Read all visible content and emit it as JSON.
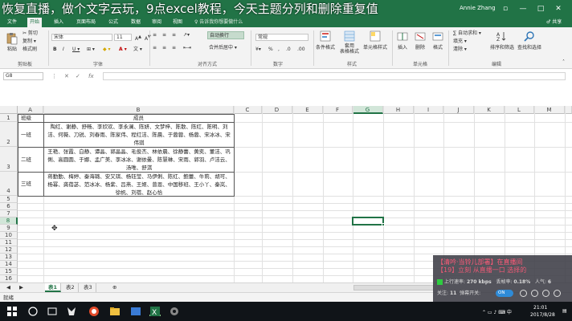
{
  "title_overlay": "恢复直播，做个文字云玩，9点excel教程，今天主题分列和删除重复值",
  "user_name": "Annie Zhang",
  "window_controls": {
    "restore": "▫",
    "minimize": "—",
    "maximize": "□",
    "close": "✕"
  },
  "menu_tabs": [
    "文件",
    "开始",
    "插入",
    "页面布局",
    "公式",
    "数据",
    "审阅",
    "视图"
  ],
  "active_tab_index": 1,
  "tell_me": "♀ 告诉我你想要做什么",
  "share": "♂ 共享",
  "ribbon": {
    "clipboard": {
      "paste": "粘贴",
      "cut": "✂ 剪切",
      "copy": "复制 ▾",
      "format_painter": "格式刷",
      "label": "剪贴板"
    },
    "font": {
      "font_name": "宋体",
      "font_size": "11",
      "label": "字体"
    },
    "alignment": {
      "wrap_text": "自动换行",
      "merge": "合并后居中 ▾",
      "label": "对齐方式"
    },
    "number": {
      "format": "常规",
      "label": "数字"
    },
    "styles": {
      "conditional": "条件格式",
      "table": "套用\n表格格式",
      "cell_styles": "单元格样式",
      "label": "样式"
    },
    "cells": {
      "insert": "插入",
      "delete": "删除",
      "format": "格式",
      "label": "单元格"
    },
    "editing": {
      "autosum": "∑ 自动求和 ▾",
      "fill": "填充 ▾",
      "clear": "清除 ▾",
      "sort": "排序和筛选",
      "find": "查找和选择",
      "label": "编辑"
    }
  },
  "name_box": "G8",
  "fx_symbols": {
    "cancel": "✕",
    "enter": "✓",
    "fx": "fx"
  },
  "columns": [
    "A",
    "B",
    "C",
    "D",
    "E",
    "F",
    "G",
    "H",
    "I",
    "J",
    "K",
    "L",
    "M"
  ],
  "selected_column": "G",
  "rows": [
    "1",
    "2",
    "3",
    "4",
    "5",
    "6",
    "7",
    "8",
    "9",
    "10",
    "11",
    "12",
    "13",
    "14",
    "15",
    "16",
    "17",
    "18",
    "19",
    "20"
  ],
  "selected_row": "8",
  "table": {
    "header": {
      "a": "班级",
      "b": "成员"
    },
    "rows": [
      {
        "class": "一班",
        "members": "陶红、谢静、舒畅、李欣欢、李永澜、陈妍、文梦梓、陈散、陈红、陈明、刘洁、何薇、刀锐、刘春雨、陈家伟、程红洁、陈晨、于蓉蓉、杨蓉、宋冰冰、宋伟琪"
      },
      {
        "class": "二班",
        "members": "王艳、张霞、白静、谭晶、郭晶晶、毛俊杰、林依晨、徐静蕾、黄奕、董洁、巩俐、高圆圆、于娜、孟广美、李冰冰、谢依曼、陈慧琳、宋雨、郭羽、卢洁云、汤唯、舒淇"
      },
      {
        "class": "三班",
        "members": "蒋勤勤、梅婷、秦海璐、安又琪、杨钰莹、马伊俐、陈红、鲍蕾、牛莉、胡可、杨幂、龚蓓苾、范冰冰、杨紫、吕燕、王姬、曾恩、中国移班、王小丫、秦岚、徐帆、刘蓓、赵心恰"
      }
    ]
  },
  "sheet_tabs": [
    "表1",
    "表2",
    "表3"
  ],
  "active_sheet_index": 0,
  "add_sheet": "⊕",
  "status": "就绪",
  "overlay": {
    "line1": "【清吟·当铃儿部署】在直播间",
    "line2": "【19】立刻 从直播一口 选择的",
    "upload_label": "上行速率:",
    "upload_value": "270 kbps",
    "loss_label": "丢帧率:",
    "loss_value": "0.18%",
    "viewers_label": "人气:",
    "viewers_value": "6",
    "follow_label": "关注:",
    "follow_value": "11",
    "danmaku_label": "弹幕开关:",
    "toggle": "ON"
  },
  "taskbar": {
    "time": "21:01",
    "date": "2017/8/28"
  }
}
